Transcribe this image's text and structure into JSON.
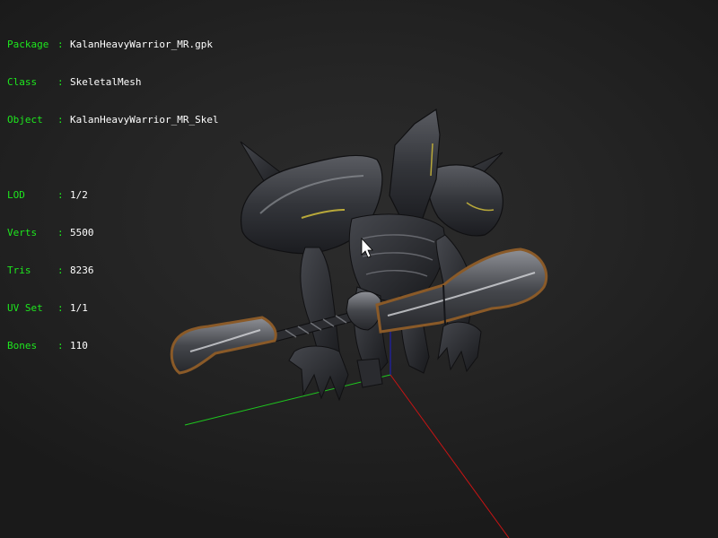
{
  "info": {
    "package": {
      "key": "Package",
      "sep": ":",
      "value": "KalanHeavyWarrior_MR.gpk"
    },
    "class": {
      "key": "Class",
      "sep": ":",
      "value": "SkeletalMesh"
    },
    "object": {
      "key": "Object",
      "sep": ":",
      "value": "KalanHeavyWarrior_MR_Skel"
    },
    "lod": {
      "key": "LOD",
      "sep": ":",
      "value": "1/2"
    },
    "verts": {
      "key": "Verts",
      "sep": ":",
      "value": "5500"
    },
    "tris": {
      "key": "Tris",
      "sep": ":",
      "value": "8236"
    },
    "uvset": {
      "key": "UV Set",
      "sep": ":",
      "value": "1/1"
    },
    "bones": {
      "key": "Bones",
      "sep": ":",
      "value": "110"
    }
  },
  "colors": {
    "label": "#1ee81e",
    "value": "#ffffff",
    "axis_x": "#c81414",
    "axis_y": "#1ec81e",
    "axis_z": "#1e1ec8",
    "background": "#252525"
  },
  "icons": {
    "cursor": "mouse-pointer-icon"
  }
}
